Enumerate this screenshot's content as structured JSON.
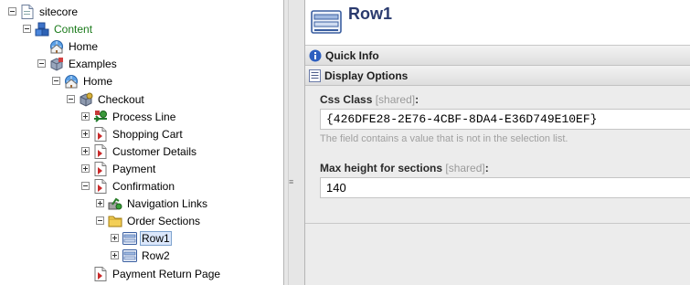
{
  "tree": {
    "nodes": [
      {
        "label": "sitecore",
        "indent": 0,
        "expander": "minus",
        "icon": "document-icon"
      },
      {
        "label": "Content",
        "indent": 1,
        "expander": "minus",
        "icon": "content-cubes-icon",
        "color": "#1a7a1a"
      },
      {
        "label": "Home",
        "indent": 2,
        "expander": "none",
        "icon": "home-globe-icon"
      },
      {
        "label": "Examples",
        "indent": 2,
        "expander": "minus",
        "icon": "examples-box-icon"
      },
      {
        "label": "Home",
        "indent": 3,
        "expander": "minus",
        "icon": "home-globe-icon"
      },
      {
        "label": "Checkout",
        "indent": 4,
        "expander": "minus",
        "icon": "checkout-box-icon"
      },
      {
        "label": "Process Line",
        "indent": 5,
        "expander": "plus",
        "icon": "process-line-icon"
      },
      {
        "label": "Shopping Cart",
        "indent": 5,
        "expander": "plus",
        "icon": "page-icon"
      },
      {
        "label": "Customer Details",
        "indent": 5,
        "expander": "plus",
        "icon": "page-icon"
      },
      {
        "label": "Payment",
        "indent": 5,
        "expander": "plus",
        "icon": "page-icon"
      },
      {
        "label": "Confirmation",
        "indent": 5,
        "expander": "minus",
        "icon": "page-icon"
      },
      {
        "label": "Navigation Links",
        "indent": 6,
        "expander": "plus",
        "icon": "navigation-links-icon"
      },
      {
        "label": "Order Sections",
        "indent": 6,
        "expander": "minus",
        "icon": "folder-icon"
      },
      {
        "label": "Row1",
        "indent": 7,
        "expander": "plus",
        "icon": "row-icon",
        "selected": true
      },
      {
        "label": "Row2",
        "indent": 7,
        "expander": "plus",
        "icon": "row-icon"
      },
      {
        "label": "Payment Return Page",
        "indent": 5,
        "expander": "none",
        "icon": "page-icon"
      }
    ]
  },
  "header": {
    "title": "Row1",
    "icon": "row-icon"
  },
  "sections": {
    "quick_info": {
      "label": "Quick Info",
      "icon": "info-icon"
    },
    "display_options": {
      "label": "Display Options",
      "icon": "display-options-icon"
    }
  },
  "fields": {
    "css_class": {
      "label": "Css Class",
      "shared": "[shared]",
      "colon": ":",
      "value": "{426DFE28-2E76-4CBF-8DA4-E36D749E10EF}",
      "hint": "The field contains a value that is not in the selection list."
    },
    "max_height": {
      "label": "Max height for sections",
      "shared": "[shared]",
      "colon": ":",
      "value": "140"
    }
  },
  "splitter": {
    "grip": "≡"
  },
  "colors": {
    "title": "#2a3a6e",
    "selection": "#dbe7fb",
    "content_node": "#1a7a1a"
  }
}
